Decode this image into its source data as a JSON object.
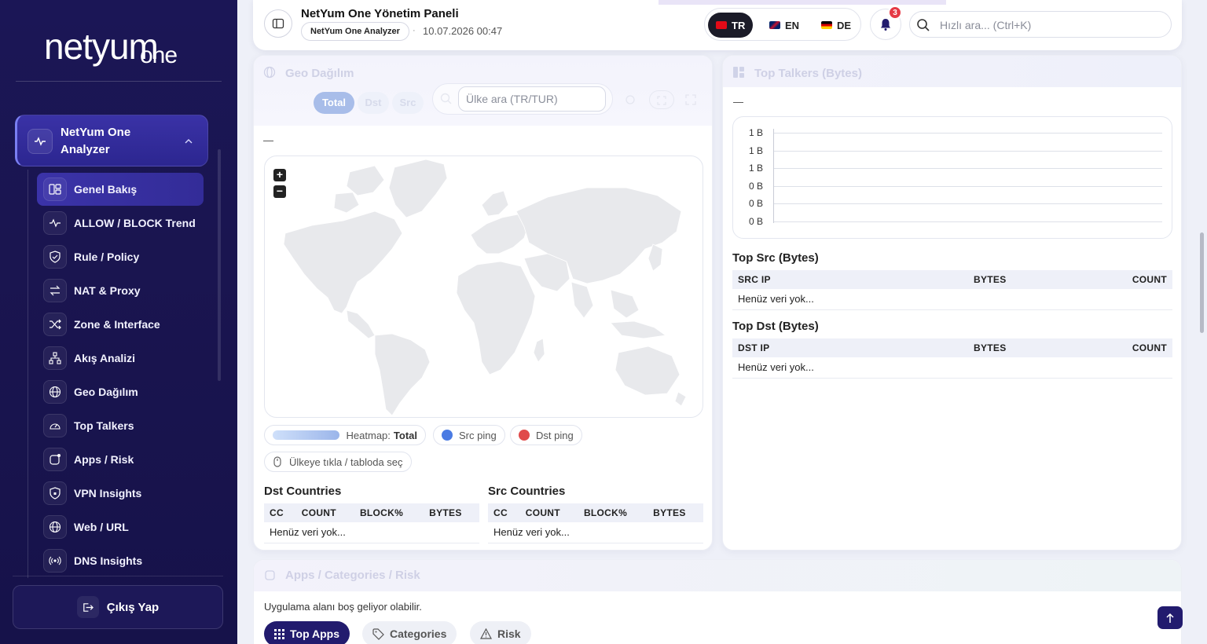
{
  "brand": {
    "logo_main": "netyum",
    "logo_sub": "one"
  },
  "sidebar": {
    "group_title": "NetYum One Analyzer",
    "items": [
      {
        "label": "Genel Bakış",
        "icon": "dashboard-icon",
        "active": true
      },
      {
        "label": "ALLOW / BLOCK Trend",
        "icon": "activity-icon"
      },
      {
        "label": "Rule / Policy",
        "icon": "shield-icon"
      },
      {
        "label": "NAT & Proxy",
        "icon": "swap-icon"
      },
      {
        "label": "Zone & Interface",
        "icon": "shuffle-icon"
      },
      {
        "label": "Akış Analizi",
        "icon": "network-icon"
      },
      {
        "label": "Geo Dağılım",
        "icon": "globe-icon"
      },
      {
        "label": "Top Talkers",
        "icon": "gauge-icon"
      },
      {
        "label": "Apps / Risk",
        "icon": "apps-icon"
      },
      {
        "label": "VPN Insights",
        "icon": "shield-lock-icon"
      },
      {
        "label": "Web / URL",
        "icon": "globe-icon"
      },
      {
        "label": "DNS Insights",
        "icon": "broadcast-icon"
      }
    ],
    "logout_label": "Çıkış Yap"
  },
  "header": {
    "title": "NetYum One Yönetim Paneli",
    "app_pill": "NetYum One Analyzer",
    "separator": "·",
    "datetime": "10.07.2026 00:47",
    "languages": [
      {
        "code": "TR",
        "active": true
      },
      {
        "code": "EN",
        "active": false
      },
      {
        "code": "DE",
        "active": false
      }
    ],
    "notification_count": "3",
    "search_placeholder": "Hızlı ara... (Ctrl+K)"
  },
  "geo": {
    "title": "Geo Dağılım",
    "segments": [
      "Total",
      "Dst",
      "Src"
    ],
    "country_search_placeholder": "Ülke ara (TR/TUR)",
    "dash": "—",
    "zoom_in": "+",
    "zoom_out": "−",
    "legend": {
      "heatmap_label": "Heatmap:",
      "heatmap_value": "Total",
      "src_ping": "Src ping",
      "dst_ping": "Dst ping",
      "hint": "Ülkeye tıkla / tabloda seç"
    },
    "dst_title": "Dst Countries",
    "src_title": "Src Countries",
    "columns": [
      "CC",
      "COUNT",
      "BLOCK%",
      "BYTES"
    ],
    "empty": "Henüz veri yok..."
  },
  "talkers": {
    "title": "Top Talkers (Bytes)",
    "dash": "—",
    "yticks": [
      "1 B",
      "1 B",
      "1 B",
      "0 B",
      "0 B",
      "0 B"
    ],
    "src_title": "Top Src (Bytes)",
    "src_columns": [
      "SRC IP",
      "BYTES",
      "COUNT"
    ],
    "dst_title": "Top Dst (Bytes)",
    "dst_columns": [
      "DST IP",
      "BYTES",
      "COUNT"
    ],
    "empty": "Henüz veri yok..."
  },
  "apps": {
    "title": "Apps / Categories / Risk",
    "note": "Uygulama alanı boş geliyor olabilir.",
    "tabs": [
      {
        "label": "Top Apps",
        "active": true
      },
      {
        "label": "Categories",
        "active": false
      },
      {
        "label": "Risk",
        "active": false
      }
    ]
  },
  "colors": {
    "sidebar_bg": "#1b1656",
    "accent": "#221b6e",
    "src_ping": "#4a7be3",
    "dst_ping": "#e04a4a",
    "badge": "#e53945"
  }
}
